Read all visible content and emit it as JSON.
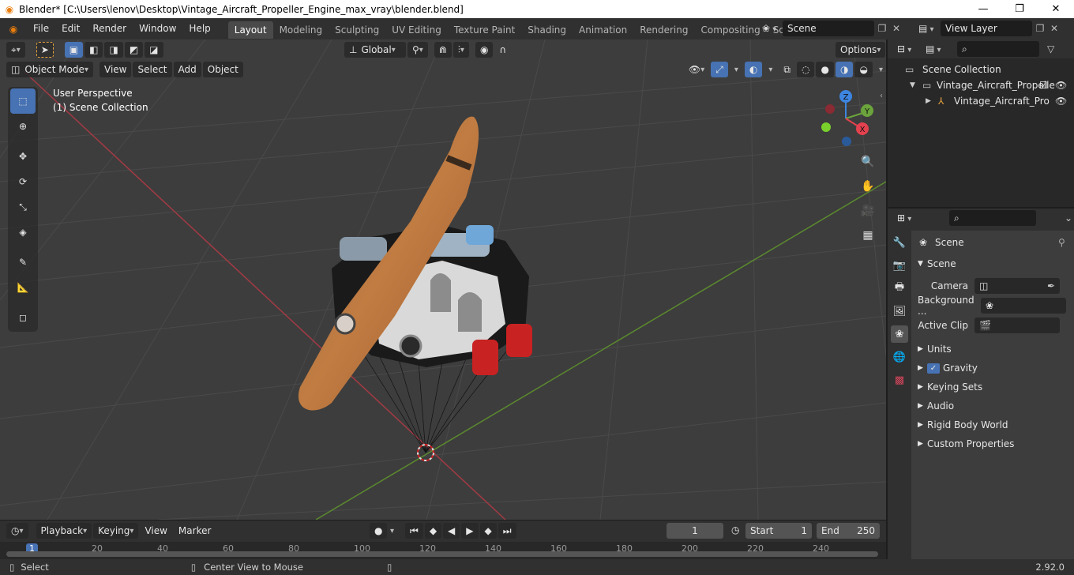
{
  "window": {
    "title": "Blender* [C:\\Users\\lenov\\Desktop\\Vintage_Aircraft_Propeller_Engine_max_vray\\blender.blend]",
    "min_symbol": "—",
    "max_symbol": "❐",
    "close_symbol": "✕"
  },
  "menubar": {
    "menus": [
      "File",
      "Edit",
      "Render",
      "Window",
      "Help"
    ],
    "workspaces": [
      "Layout",
      "Modeling",
      "Sculpting",
      "UV Editing",
      "Texture Paint",
      "Shading",
      "Animation",
      "Rendering",
      "Compositing",
      "Scripting"
    ],
    "active_workspace": "Layout",
    "scene_value": "Scene",
    "view_layer_value": "View Layer"
  },
  "viewport": {
    "mode": "Object Mode",
    "menus": [
      "View",
      "Select",
      "Add",
      "Object"
    ],
    "transform_orientation": "Global",
    "options_label": "Options",
    "overlay_line1": "User Perspective",
    "overlay_line2": "(1) Scene Collection",
    "gizmo_labels": {
      "z": "Z",
      "y": "Y",
      "x": "X"
    }
  },
  "outliner": {
    "root": "Scene Collection",
    "collection": "Vintage_Aircraft_Propelle",
    "object": "Vintage_Aircraft_Pro"
  },
  "properties": {
    "context_title": "Scene",
    "panel_title": "Scene",
    "fields": [
      {
        "label": "Camera"
      },
      {
        "label": "Background ..."
      },
      {
        "label": "Active Clip"
      }
    ],
    "subpanels": [
      "Units",
      "Gravity",
      "Keying Sets",
      "Audio",
      "Rigid Body World",
      "Custom Properties"
    ],
    "gravity_checked": true
  },
  "timeline": {
    "menus": [
      "Playback",
      "Keying",
      "View",
      "Marker"
    ],
    "current_frame": "1",
    "start_label": "Start",
    "start_value": "1",
    "end_label": "End",
    "end_value": "250",
    "ruler_ticks": [
      "1",
      "20",
      "40",
      "60",
      "80",
      "100",
      "120",
      "140",
      "160",
      "180",
      "200",
      "220",
      "240"
    ]
  },
  "statusbar": {
    "left_action": "Select",
    "middle_action": "Center View to Mouse",
    "version": "2.92.0"
  },
  "colors": {
    "accent": "#4772b3",
    "x_axis": "#e4414f",
    "y_axis": "#6ba33c",
    "z_axis": "#3d85e0",
    "propeller": "#b8723c"
  }
}
